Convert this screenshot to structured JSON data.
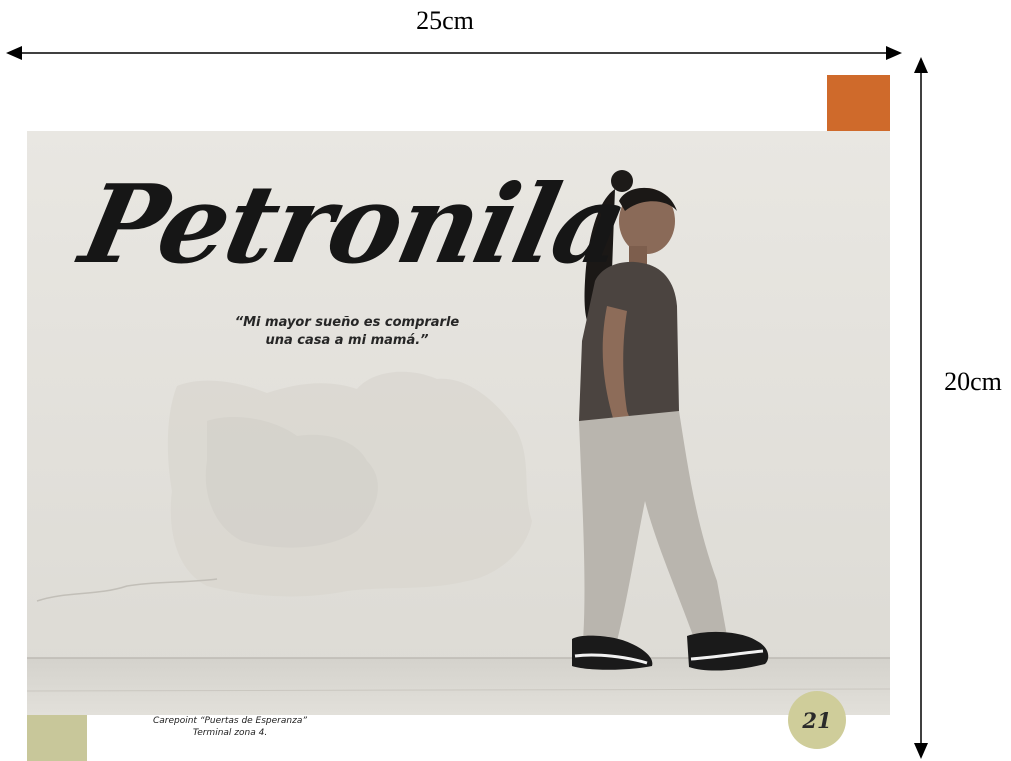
{
  "dimensions": {
    "width_label": "25cm",
    "height_label": "20cm"
  },
  "page": {
    "title": "Petronila",
    "quote_line_1": "“Mi mayor sueño es comprarle",
    "quote_line_2": "una casa a mi mamá.”",
    "caption_line_1": "Carepoint “Puertas de Esperanza”",
    "caption_line_2": "Terminal zona 4.",
    "page_number": "21"
  },
  "colors": {
    "accent_orange": "#cf6a2b",
    "accent_olive": "#c8c79a",
    "photo_wall": "#e4e2dd"
  }
}
